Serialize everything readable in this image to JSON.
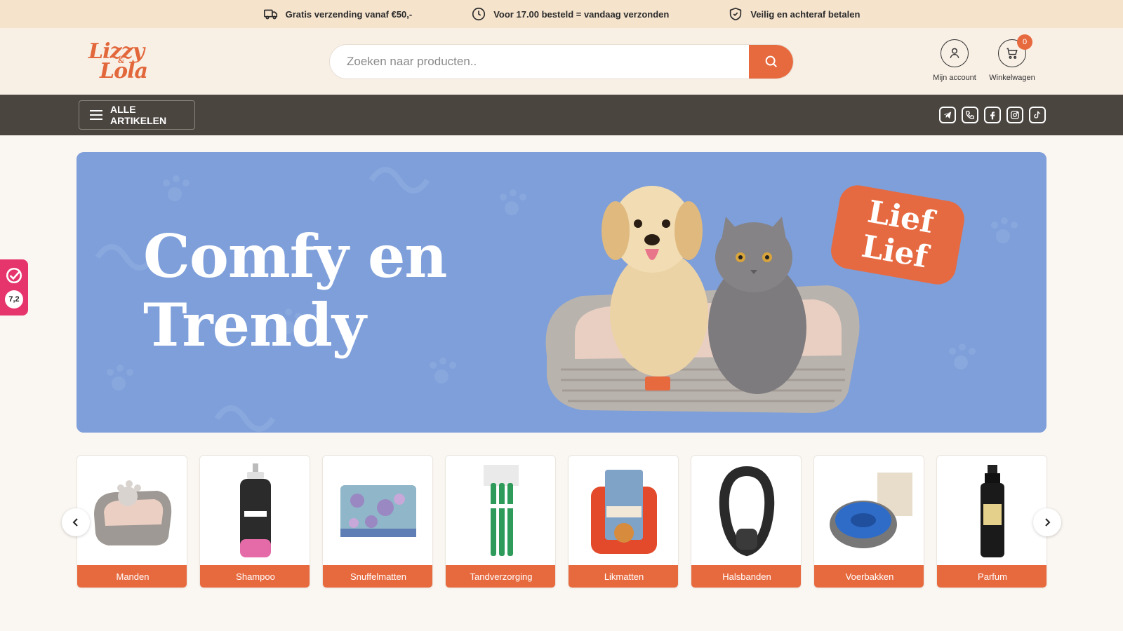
{
  "usp_bar": {
    "items": [
      {
        "icon": "truck-icon",
        "text": "Gratis verzending vanaf €50,-"
      },
      {
        "icon": "clock-icon",
        "text": "Voor 17.00 besteld = vandaag verzonden"
      },
      {
        "icon": "shield-icon",
        "text": "Veilig en achteraf betalen"
      }
    ]
  },
  "header": {
    "logo": {
      "line1": "Lizzy",
      "amp": "&",
      "line2": "Lola"
    },
    "search": {
      "placeholder": "Zoeken naar producten.."
    },
    "account_label": "Mijn account",
    "cart_label": "Winkelwagen",
    "cart_count": "0"
  },
  "nav": {
    "all_label": "ALLE ARTIKELEN",
    "socials": [
      "telegram-icon",
      "phone-icon",
      "facebook-icon",
      "instagram-icon",
      "tiktok-icon"
    ]
  },
  "hero": {
    "title_line1": "Comfy en",
    "title_line2": "Trendy",
    "badge_line1": "Lief",
    "badge_line2": "Lief"
  },
  "review_widget": {
    "score": "7,2"
  },
  "categories": [
    {
      "label": "Manden"
    },
    {
      "label": "Shampoo"
    },
    {
      "label": "Snuffelmatten"
    },
    {
      "label": "Tandverzorging"
    },
    {
      "label": "Likmatten"
    },
    {
      "label": "Halsbanden"
    },
    {
      "label": "Voerbakken"
    },
    {
      "label": "Parfum"
    }
  ],
  "colors": {
    "accent": "#e76a3f",
    "usp_bg": "#f5e3cc",
    "nav_bg": "#4b4540",
    "hero_bg": "#7e9fda",
    "review_bg": "#e6356d"
  }
}
